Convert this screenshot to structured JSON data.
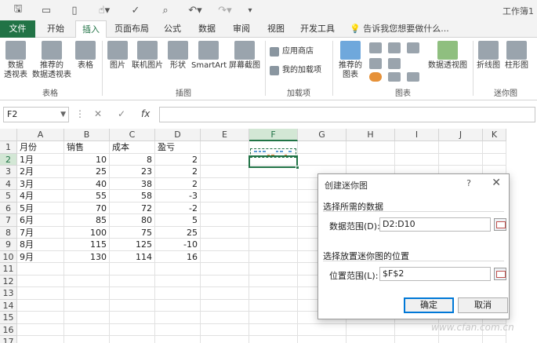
{
  "window": {
    "workbook_title": "工作簿1"
  },
  "ribbon_tabs": [
    {
      "label": "文件"
    },
    {
      "label": "开始"
    },
    {
      "label": "插入"
    },
    {
      "label": "页面布局"
    },
    {
      "label": "公式"
    },
    {
      "label": "数据"
    },
    {
      "label": "审阅"
    },
    {
      "label": "视图"
    },
    {
      "label": "开发工具"
    }
  ],
  "tell_me": "告诉我您想要做什么...",
  "ribbon": {
    "btn_pivot": "数据\n透视表",
    "btn_rec_pivot": "推荐的\n数据透视表",
    "btn_table": "表格",
    "grp_tables": "表格",
    "btn_picture": "图片",
    "btn_online_pic": "联机图片",
    "btn_shapes": "形状",
    "btn_smartart": "SmartArt",
    "btn_screenshot": "屏幕截图",
    "grp_illustrations": "插图",
    "btn_store": "应用商店",
    "btn_myaddins": "我的加载项",
    "grp_addins": "加载项",
    "btn_rec_charts": "推荐的\n图表",
    "btn_pivot_chart": "数据透视图",
    "grp_charts": "图表",
    "btn_sparkline_line": "折线图",
    "btn_sparkline_col": "柱形图",
    "grp_sparklines": "迷你图"
  },
  "formula_bar": {
    "name_box": "F2",
    "fx": "fx",
    "cancel": "✕",
    "enter": "✓"
  },
  "columns": [
    "A",
    "B",
    "C",
    "D",
    "E",
    "F",
    "G",
    "H",
    "I",
    "J",
    "K"
  ],
  "rows": [
    "1",
    "2",
    "3",
    "4",
    "5",
    "6",
    "7",
    "8",
    "9",
    "10",
    "11",
    "12",
    "13",
    "14",
    "15",
    "16",
    "17"
  ],
  "table": {
    "headers": [
      "月份",
      "销售",
      "成本",
      "盈亏"
    ],
    "data": [
      [
        "1月",
        "10",
        "8",
        "2"
      ],
      [
        "2月",
        "25",
        "23",
        "2"
      ],
      [
        "3月",
        "40",
        "38",
        "2"
      ],
      [
        "4月",
        "55",
        "58",
        "-3"
      ],
      [
        "5月",
        "70",
        "72",
        "-2"
      ],
      [
        "6月",
        "85",
        "80",
        "5"
      ],
      [
        "7月",
        "100",
        "75",
        "25"
      ],
      [
        "8月",
        "115",
        "125",
        "-10"
      ],
      [
        "9月",
        "130",
        "114",
        "16"
      ]
    ]
  },
  "dialog": {
    "title": "创建迷你图",
    "help": "?",
    "close": "✕",
    "section_data": "选择所需的数据",
    "data_range_label": "数据范围(D):",
    "data_range_value": "D2:D10",
    "section_location": "选择放置迷你图的位置",
    "location_label": "位置范围(L):",
    "location_value": "$F$2",
    "ok": "确定",
    "cancel": "取消"
  },
  "watermark": "www.cfan.com.cn",
  "colors": {
    "excel_green": "#217346",
    "sparkline_pos": "#5b9bd5",
    "sparkline_neg": "#ed7d31"
  }
}
